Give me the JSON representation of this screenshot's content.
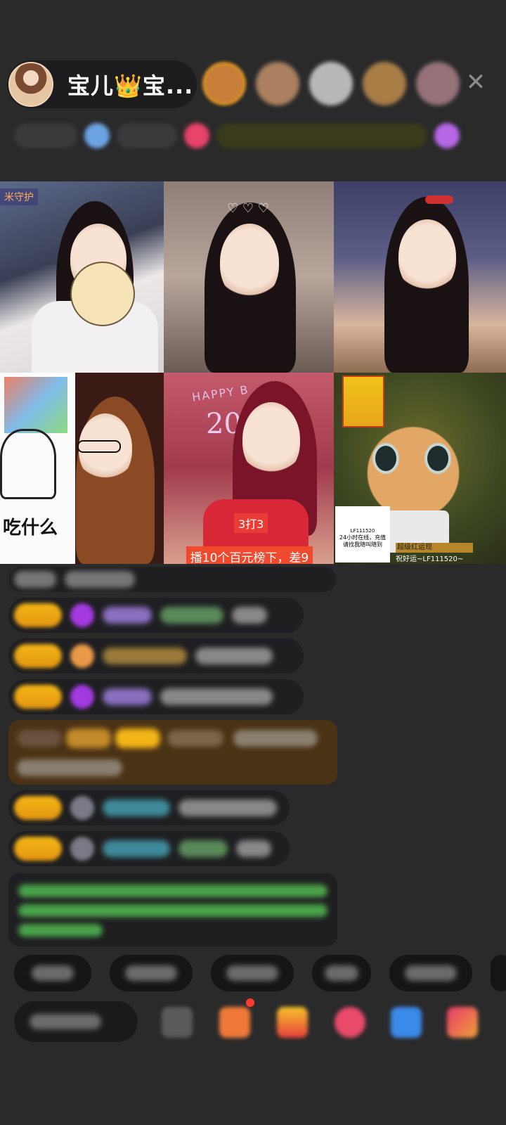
{
  "header": {
    "host_name": "宝儿👑宝...",
    "close_icon": "close-icon",
    "viewer_avatar_colors": [
      "#d8883a",
      "#b88a66",
      "#c8c8c8",
      "#b6864a",
      "#a07a80"
    ]
  },
  "grid": {
    "tiles": [
      {
        "tag": "米守护"
      },
      {
        "tag": ""
      },
      {
        "tag": ""
      },
      {
        "meme_text": "吃什么"
      },
      {
        "happy_text": "HAPPY B",
        "number_text": "20",
        "badge": "3打3",
        "deal_text": "播10个百元榜下，差9"
      },
      {
        "qr_id": "LF111520",
        "qr_text": "24小时在线，充值请找我随叫随到",
        "luck_text": "超级红运现",
        "luck_id": "祝好运~LF111520~"
      }
    ]
  },
  "chat": {
    "messages_count_visible": 8
  },
  "colors": {
    "background": "#2a2a2b",
    "badge_gold": "#f3b517",
    "system_message": "#4a3215",
    "green_text": "#4aa34a"
  },
  "toolbar": {
    "icons": [
      "chat-input",
      "emoji-icon",
      "gift-box-icon",
      "red-envelope-icon",
      "game-icon",
      "share-icon",
      "more-icon"
    ]
  }
}
